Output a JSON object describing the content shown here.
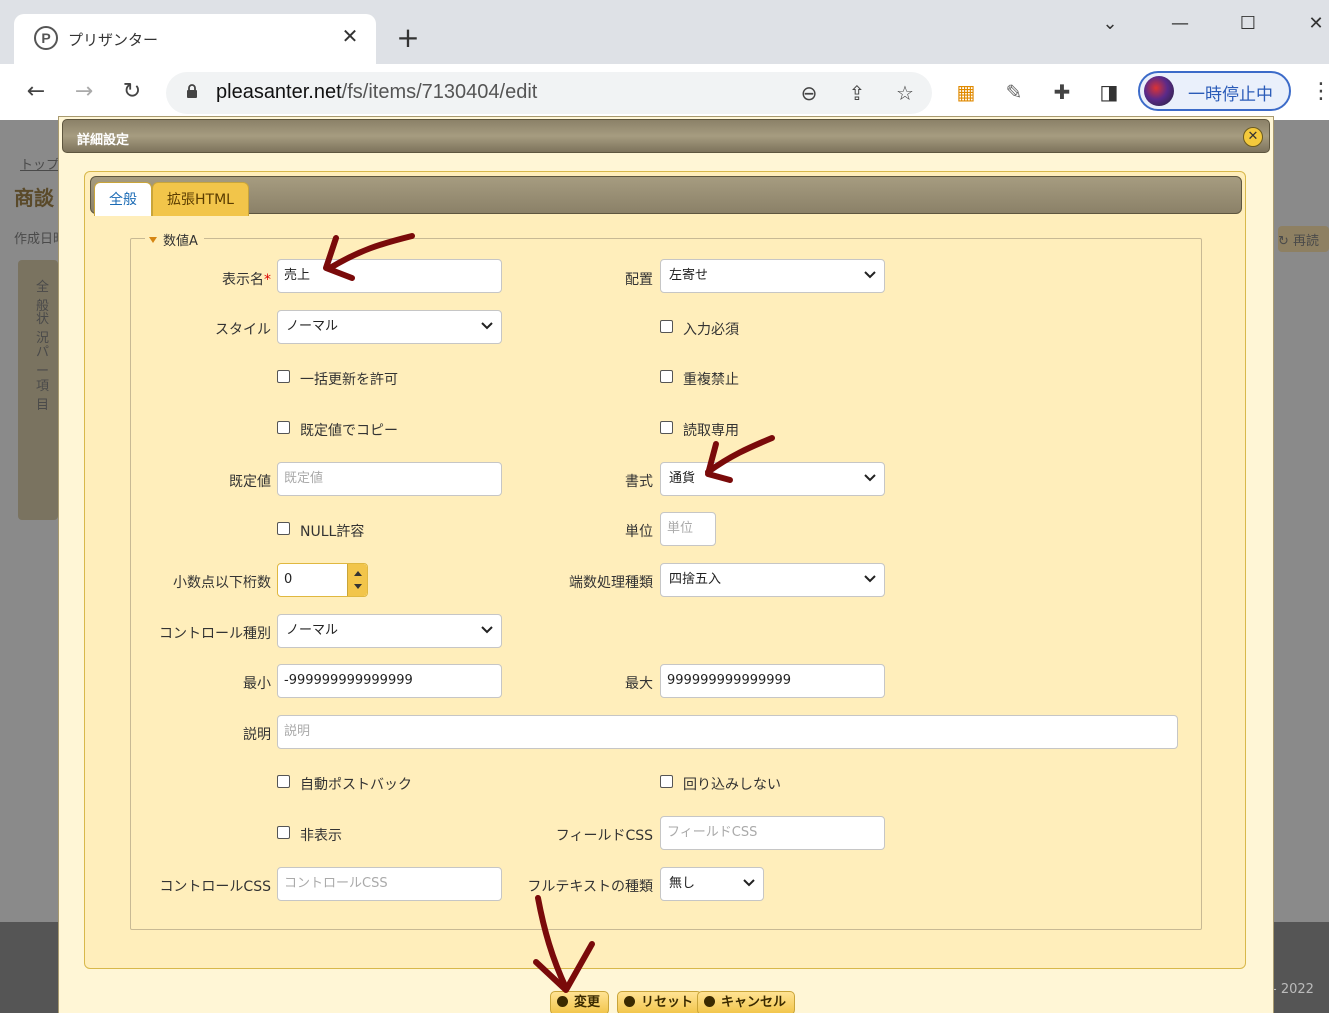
{
  "browser": {
    "tab_title": "プリザンター",
    "favicon_letter": "P",
    "url_host": "pleasanter.net",
    "url_path": "/fs/items/7130404/edit",
    "profile_label": "一時停止中"
  },
  "background_page": {
    "breadcrumb": "トップ",
    "heading": "商談",
    "created_label": "作成日時",
    "side_tabs": [
      "全般",
      "状況",
      "パー",
      "項目"
    ],
    "reload_button": "再読",
    "footer_year": "- 2022"
  },
  "dialog": {
    "title": "詳細設定",
    "tabs": [
      "全般",
      "拡張HTML"
    ],
    "fieldset_legend": "数値A",
    "fields": {
      "display_name": {
        "label": "表示名",
        "required_mark": "*",
        "value": "売上"
      },
      "alignment": {
        "label": "配置",
        "value": "左寄せ"
      },
      "style": {
        "label": "スタイル",
        "value": "ノーマル"
      },
      "required_input": {
        "label": "入力必須",
        "checked": false
      },
      "allow_bulk_update": {
        "label": "一括更新を許可",
        "checked": false
      },
      "no_duplication": {
        "label": "重複禁止",
        "checked": false
      },
      "copy_by_default": {
        "label": "既定値でコピー",
        "checked": false
      },
      "read_only": {
        "label": "読取専用",
        "checked": false
      },
      "default_value": {
        "label": "既定値",
        "placeholder": "既定値"
      },
      "format": {
        "label": "書式",
        "value": "通貨"
      },
      "nullable": {
        "label": "NULL許容",
        "checked": false
      },
      "unit": {
        "label": "単位",
        "placeholder": "単位"
      },
      "decimal_places": {
        "label": "小数点以下桁数",
        "value": "0"
      },
      "rounding_type": {
        "label": "端数処理種類",
        "value": "四捨五入"
      },
      "control_type": {
        "label": "コントロール種別",
        "value": "ノーマル"
      },
      "min": {
        "label": "最小",
        "value": "-999999999999999"
      },
      "max": {
        "label": "最大",
        "value": "999999999999999"
      },
      "description": {
        "label": "説明",
        "placeholder": "説明"
      },
      "auto_postback": {
        "label": "自動ポストバック",
        "checked": false
      },
      "no_wrap": {
        "label": "回り込みしない",
        "checked": false
      },
      "hide": {
        "label": "非表示",
        "checked": false
      },
      "field_css": {
        "label": "フィールドCSS",
        "placeholder": "フィールドCSS"
      },
      "control_css": {
        "label": "コントロールCSS",
        "placeholder": "コントロールCSS"
      },
      "full_text_type": {
        "label": "フルテキストの種類",
        "value": "無し"
      }
    },
    "buttons": {
      "change": "変更",
      "reset": "リセット",
      "cancel": "キャンセル"
    }
  },
  "colors": {
    "annotation_arrow": "#7a0a0a",
    "dialog_bg": "#fff6d6",
    "panel_bg": "#ffeebb",
    "button_gold": "#f2c54a"
  }
}
